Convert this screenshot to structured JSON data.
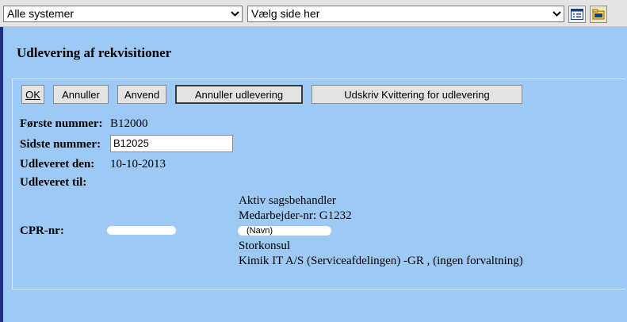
{
  "toolbar": {
    "system_select_value": "Alle systemer",
    "page_select_value": "Vælg side her",
    "list_icon": "list-view-icon",
    "folder_icon": "folder-icon"
  },
  "page": {
    "title": "Udlevering af rekvisitioner"
  },
  "buttons": {
    "ok": "OK",
    "annuller": "Annuller",
    "anvend": "Anvend",
    "annuller_udlevering": "Annuller udlevering",
    "udskriv": "Udskriv Kvittering for udlevering"
  },
  "form": {
    "first_number_label": "Første nummer:",
    "first_number_value": "B12000",
    "last_number_label": "Sidste nummer:",
    "last_number_value": "B12025",
    "issued_date_label": "Udleveret den:",
    "issued_date_value": "10-10-2013",
    "issued_to_label": "Udleveret til:",
    "cpr_label": "CPR-nr:"
  },
  "recipient": {
    "role": "Aktiv sagsbehandler",
    "employee_number": "Medarbejder-nr: G1232",
    "name_placeholder": "(Navn)",
    "title": "Storkonsul",
    "organisation": "Kimik IT A/S (Serviceafdelingen) -GR , (ingen forvaltning)"
  },
  "colors": {
    "background": "#9ec9f5",
    "toolbar": "#e4e4e4",
    "accent_stripe": "#1f2e86"
  }
}
